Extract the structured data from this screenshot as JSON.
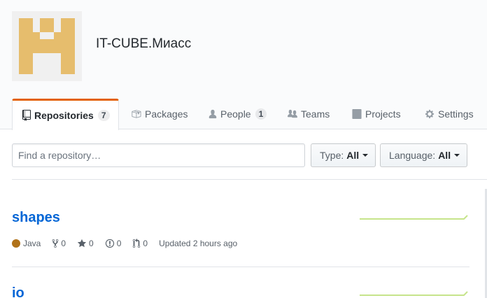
{
  "org": {
    "name": "IT-CUBE.Миасс",
    "avatar_color": "#e6bd6d"
  },
  "tabs": [
    {
      "label": "Repositories",
      "count": "7",
      "icon": "repo-icon",
      "selected": true
    },
    {
      "label": "Packages",
      "icon": "package-icon"
    },
    {
      "label": "People",
      "count": "1",
      "icon": "person-icon"
    },
    {
      "label": "Teams",
      "icon": "people-icon"
    },
    {
      "label": "Projects",
      "icon": "project-icon"
    },
    {
      "label": "Settings",
      "icon": "gear-icon"
    }
  ],
  "filter": {
    "placeholder": "Find a repository…",
    "type_label": "Type:",
    "type_value": "All",
    "language_label": "Language:",
    "language_value": "All"
  },
  "repos": [
    {
      "name": "shapes",
      "language": "Java",
      "language_color": "#b07219",
      "forks": "0",
      "stars": "0",
      "issues": "0",
      "pulls": "0",
      "updated": "Updated 2 hours ago"
    },
    {
      "name": "io"
    }
  ],
  "colors": {
    "accent_tab": "#e36209",
    "link": "#0366d6",
    "sparkline": "#c6e48b"
  }
}
